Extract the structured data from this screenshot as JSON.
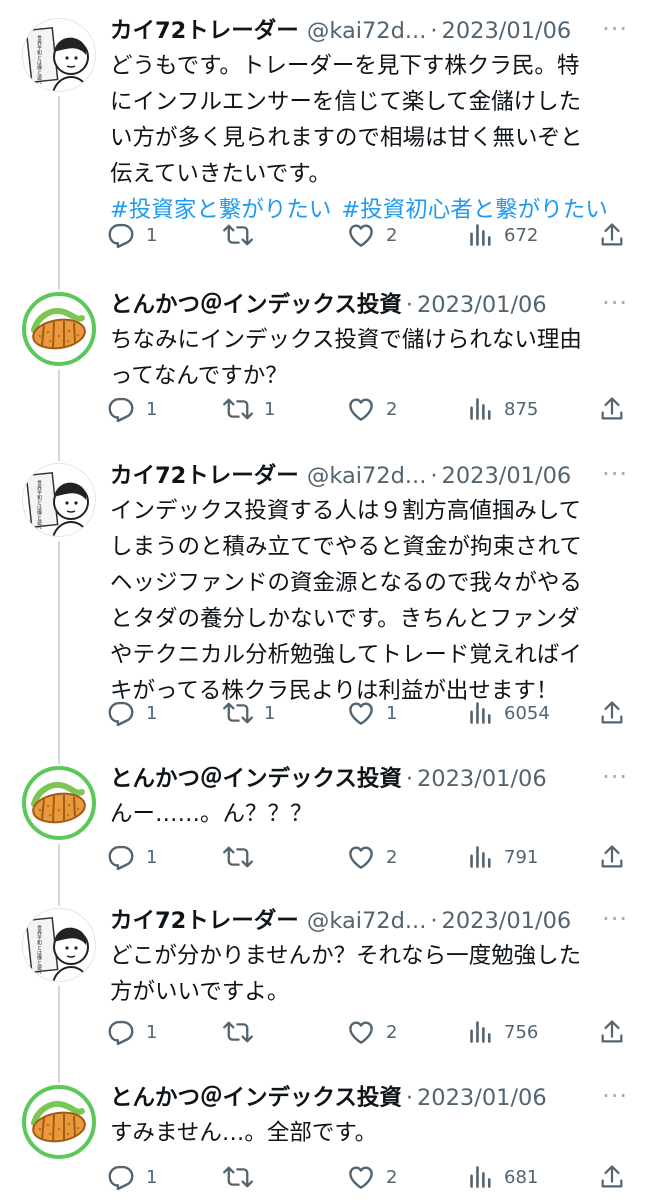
{
  "tweets": [
    {
      "author": "kai",
      "name": "カイ72トレーダー",
      "handle": "@kai72d...",
      "date": "2023/01/06",
      "lines": [
        "どうもです。トレーダーを見下す株クラ民。特",
        "にインフルエンサーを信じて楽して金儲けした",
        "い方が多く見られますので相場は甘く無いぞと",
        "伝えていきたいです。"
      ],
      "hashtags": [
        "#投資家と繋がりたい",
        "#投資初心者と繋がりたい"
      ],
      "replies": "1",
      "retweets": "",
      "likes": "2",
      "views": "672"
    },
    {
      "author": "ton",
      "name": "とんかつ＠インデックス投資",
      "handle": "",
      "date": "2023/01/06",
      "lines": [
        "ちなみにインデックス投資で儲けられない理由",
        "ってなんですか？"
      ],
      "hashtags": [],
      "replies": "1",
      "retweets": "1",
      "likes": "2",
      "views": "875"
    },
    {
      "author": "kai",
      "name": "カイ72トレーダー",
      "handle": "@kai72d...",
      "date": "2023/01/06",
      "lines": [
        "インデックス投資する人は９割方高値掴みして",
        "しまうのと積み立てでやると資金が拘束されて",
        "ヘッジファンドの資金源となるので我々がやる",
        "とタダの養分しかないです。きちんとファンダ",
        "やテクニカル分析勉強してトレード覚えればイ",
        "キがってる株クラ民よりは利益が出せます！"
      ],
      "hashtags": [],
      "replies": "1",
      "retweets": "1",
      "likes": "1",
      "views": "6054"
    },
    {
      "author": "ton",
      "name": "とんかつ＠インデックス投資",
      "handle": "",
      "date": "2023/01/06",
      "lines": [
        "んー……。ん？？？"
      ],
      "hashtags": [],
      "replies": "1",
      "retweets": "",
      "likes": "2",
      "views": "791"
    },
    {
      "author": "kai",
      "name": "カイ72トレーダー",
      "handle": "@kai72d...",
      "date": "2023/01/06",
      "lines": [
        "どこが分かりませんか？それなら一度勉強した",
        "方がいいですよ。"
      ],
      "hashtags": [],
      "replies": "1",
      "retweets": "",
      "likes": "2",
      "views": "756"
    },
    {
      "author": "ton",
      "name": "とんかつ＠インデックス投資",
      "handle": "",
      "date": "2023/01/06",
      "lines": [
        "すみません…。全部です。"
      ],
      "hashtags": [],
      "replies": "1",
      "retweets": "",
      "likes": "2",
      "views": "681"
    }
  ],
  "avatar_kai_text": "世界平和とは僕と遊べ",
  "ui": {
    "dot": "·",
    "more": "···"
  },
  "colors": {
    "link": "#1d9bf0",
    "muted": "#536471",
    "thread": "#cfd9de",
    "avatar_ring": "#5cc85a"
  },
  "icons": [
    "reply-icon",
    "retweet-icon",
    "like-icon",
    "views-icon",
    "share-icon"
  ]
}
